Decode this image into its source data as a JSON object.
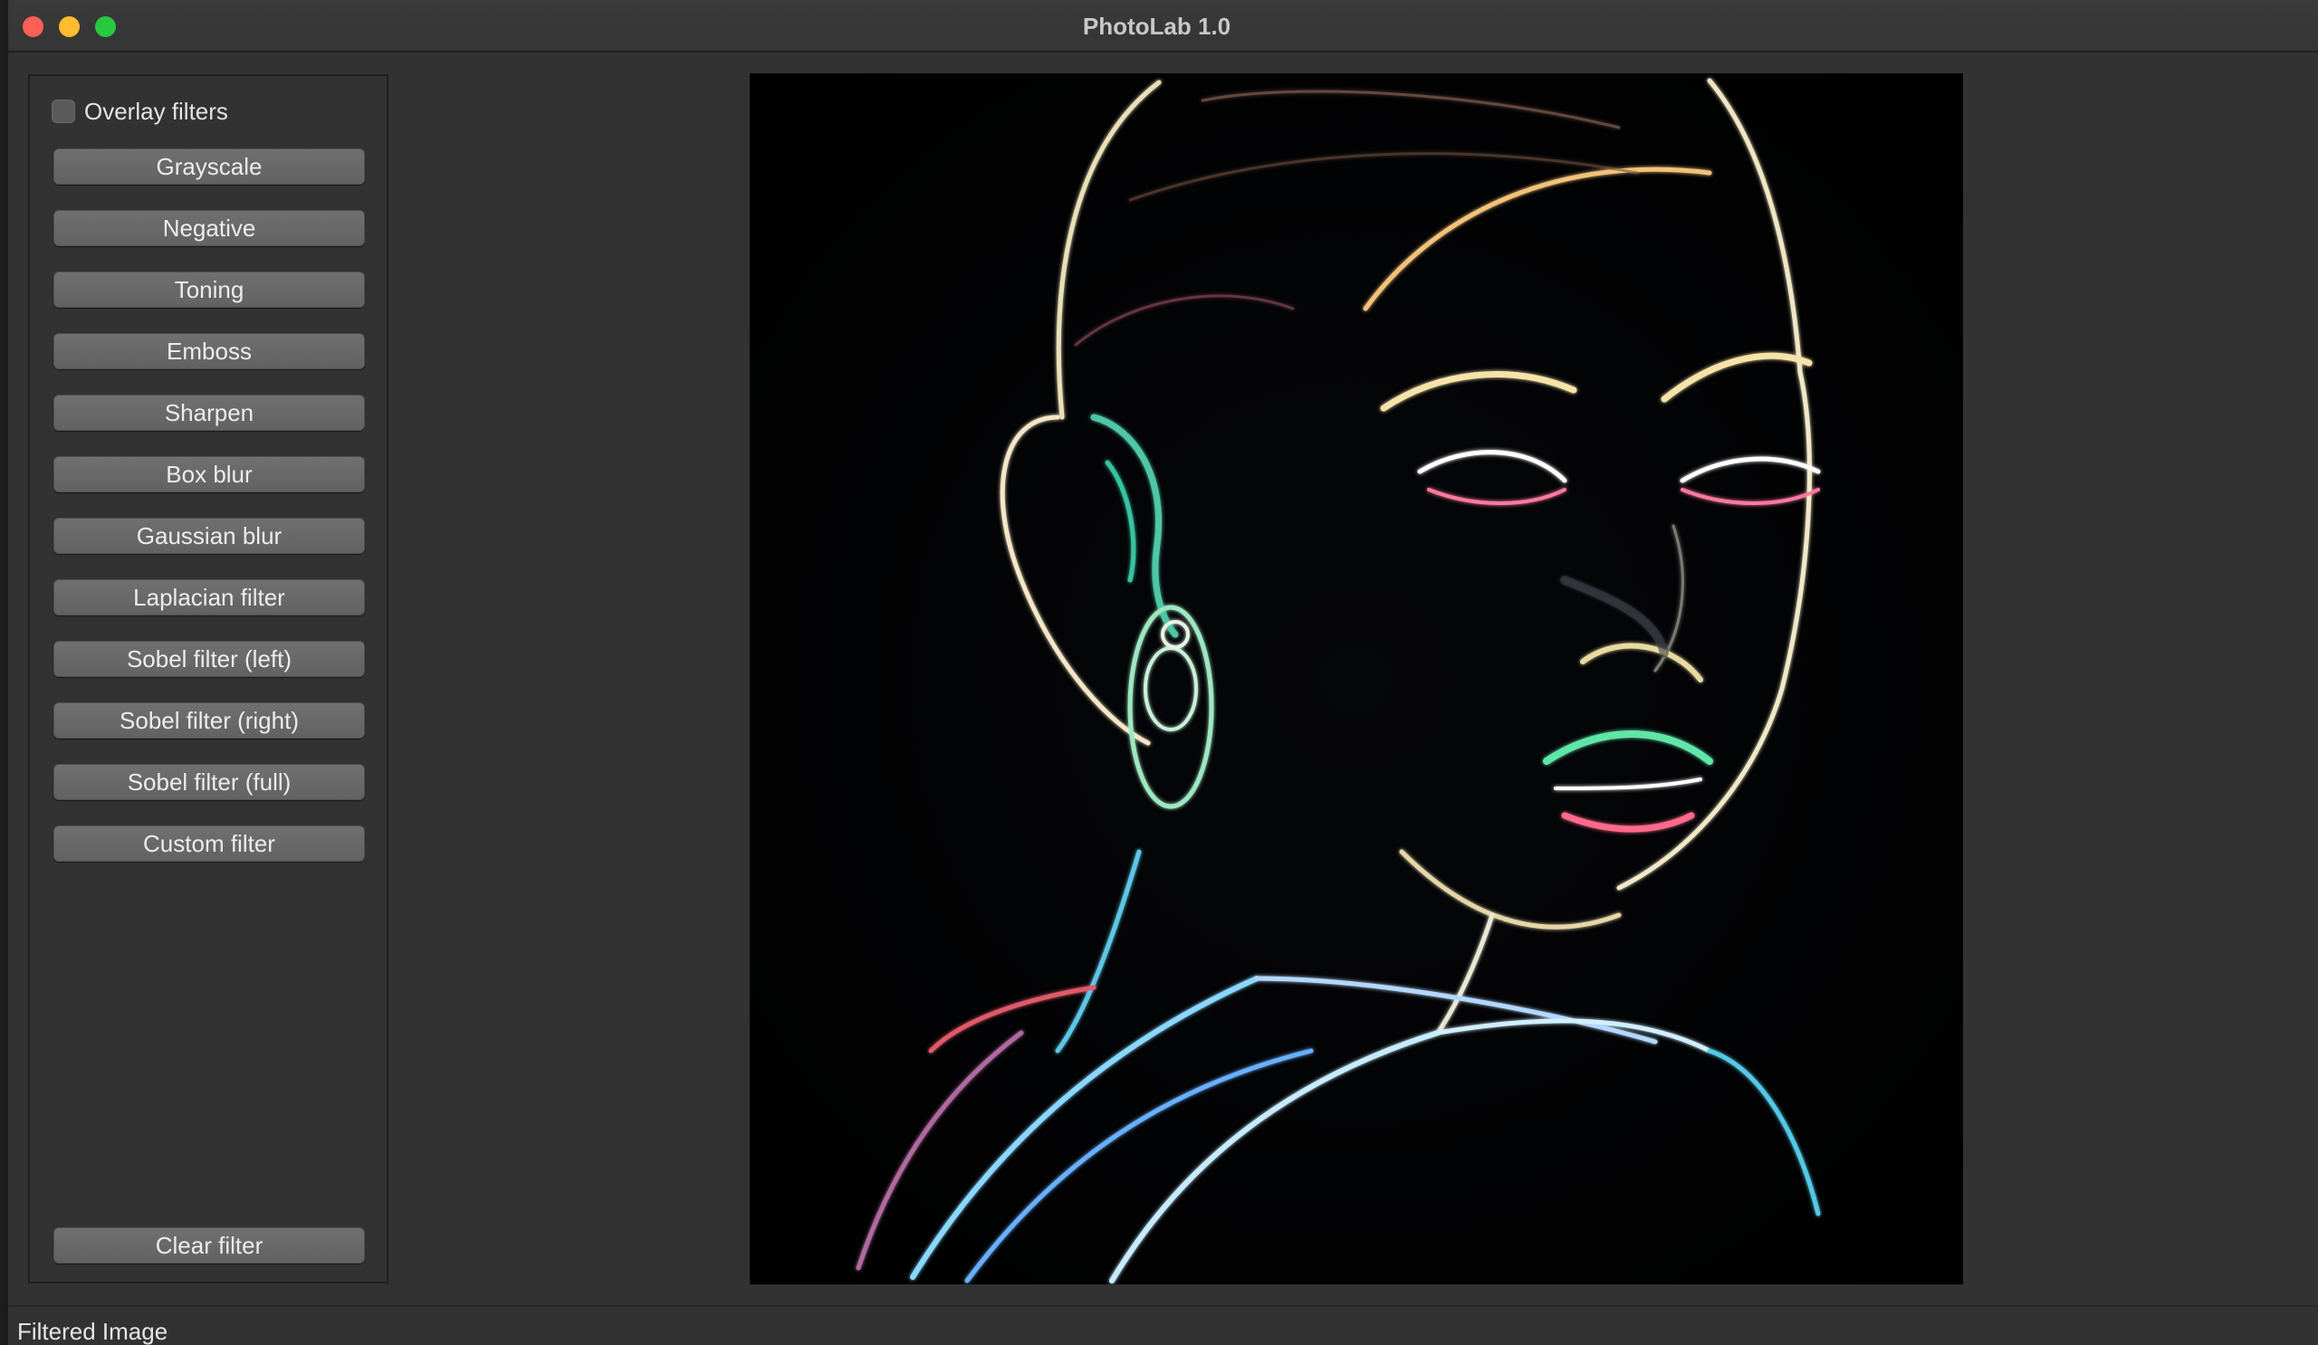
{
  "window": {
    "title": "PhotoLab 1.0"
  },
  "sidebar": {
    "overlay_label": "Overlay filters",
    "overlay_checked": false,
    "filters": [
      "Grayscale",
      "Negative",
      "Toning",
      "Emboss",
      "Sharpen",
      "Box blur",
      "Gaussian blur",
      "Laplacian filter",
      "Sobel filter (left)",
      "Sobel filter (right)",
      "Sobel filter (full)",
      "Custom filter"
    ],
    "clear_label": "Clear filter"
  },
  "image": {
    "subject": "edge-filtered portrait of a woman with earring"
  },
  "status": {
    "text": "Filtered Image"
  },
  "colors": {
    "window_bg": "#323232",
    "button": "#686868",
    "close": "#fe5f57",
    "minimize": "#febc2e",
    "maximize": "#28c840"
  }
}
